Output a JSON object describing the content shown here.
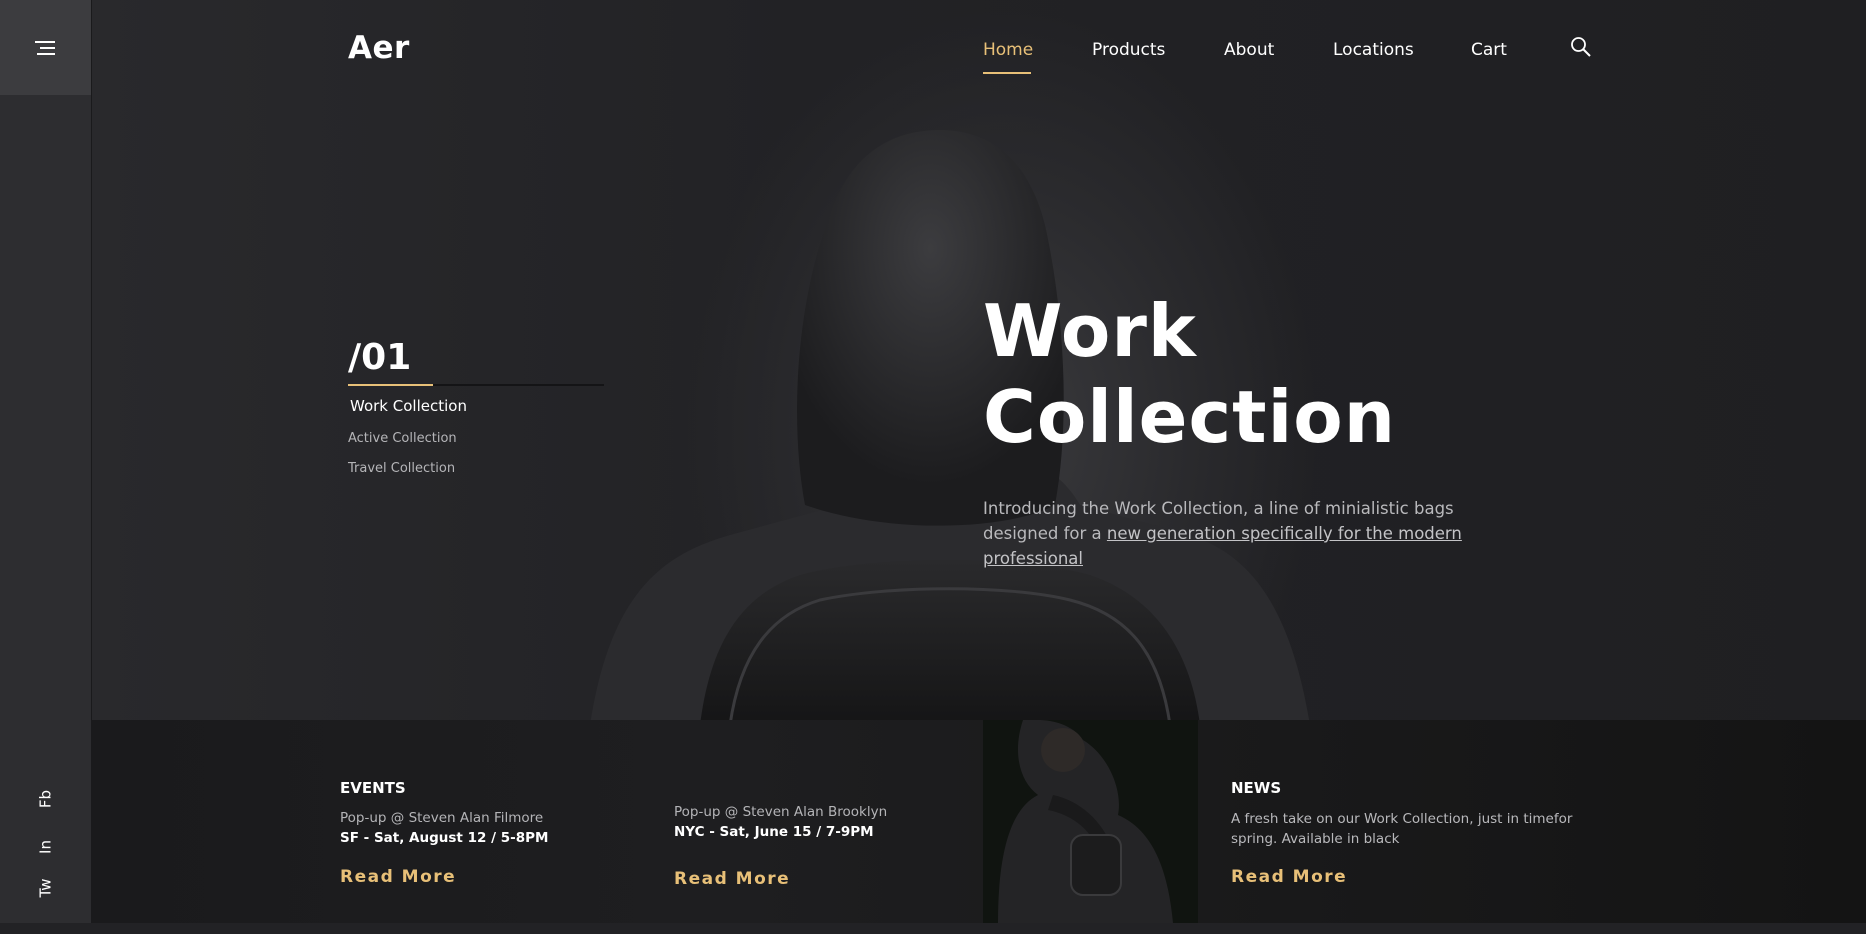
{
  "brand": {
    "logo": "Aer",
    "accent": "#e8c078"
  },
  "sidebar": {
    "menu_icon": "hamburger-icon",
    "social": [
      "Fb",
      "In",
      "Tw"
    ]
  },
  "nav": {
    "items": [
      "Home",
      "Products",
      "About",
      "Locations",
      "Cart"
    ],
    "active": "Home",
    "search_icon": "search-icon"
  },
  "slider": {
    "number": "/01",
    "collections": [
      "Work Collection",
      "Active Collection",
      "Travel Collection"
    ],
    "active_collection": "Work Collection"
  },
  "hero": {
    "title_line1": "Work",
    "title_line2": "Collection",
    "desc_plain": "Introducing the Work Collection, a line of minialistic bags designed for a ",
    "desc_link": "new generation specifically for the modern professional"
  },
  "events": {
    "heading": "EVENTS",
    "items": [
      {
        "title": "Pop-up @ Steven Alan Filmore",
        "detail": "SF - Sat, August 12 / 5-8PM",
        "cta": "Read More"
      },
      {
        "title": "Pop-up @ Steven Alan Brooklyn",
        "detail": "NYC - Sat, June 15 / 7-9PM",
        "cta": "Read More"
      }
    ]
  },
  "news": {
    "heading": "NEWS",
    "text": "A fresh take on our Work Collection, just in timefor spring. Available in black",
    "cta": "Read More"
  }
}
